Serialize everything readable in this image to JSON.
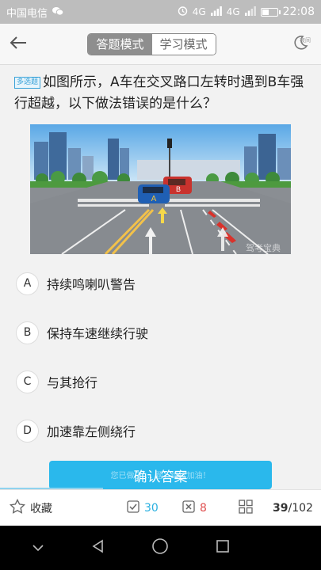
{
  "status": {
    "carrier": "中国电信",
    "network": "4G",
    "network2": "4G",
    "time": "22:08",
    "battery_level": 0.55
  },
  "header": {
    "mode_tabs": [
      "答题模式",
      "学习模式"
    ],
    "active_tab": "答题模式",
    "night_label": "夜间"
  },
  "question": {
    "type_tag": "多选题",
    "text": "如图所示，A车在交叉路口左转时遇到B车强行超越，以下做法错误的是什么？",
    "image_watermark": "驾考宝典"
  },
  "options": [
    {
      "key": "A",
      "text": "持续鸣喇叭警告"
    },
    {
      "key": "B",
      "text": "保持车速继续行驶"
    },
    {
      "key": "C",
      "text": "与其抢行"
    },
    {
      "key": "D",
      "text": "加速靠左侧绕行"
    }
  ],
  "confirm": {
    "label": "确认答案",
    "toast": "您已做了 ... 题，继续加油！"
  },
  "bottom": {
    "favorite_label": "收藏",
    "correct_count": "30",
    "wrong_count": "8",
    "current": "39",
    "total": "/102"
  },
  "colors": {
    "accent": "#2ab8ec",
    "wrong": "#e05050"
  },
  "icons": [
    "back-arrow-icon",
    "moon-icon",
    "star-icon",
    "check-icon",
    "cross-icon",
    "grid-icon",
    "nav-back-icon",
    "nav-home-icon",
    "nav-recent-icon"
  ]
}
